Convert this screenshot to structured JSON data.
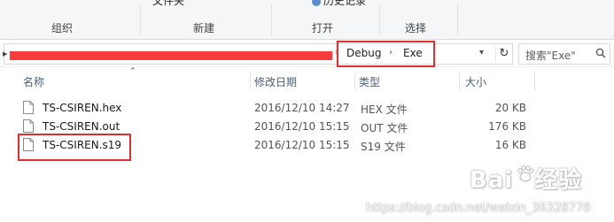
{
  "ribbon": {
    "fragments": [
      "文件夹",
      "历史记录"
    ],
    "groups": [
      "组织",
      "新建",
      "打开",
      "选择"
    ]
  },
  "address": {
    "crumbs": [
      "Debug",
      "Exe"
    ],
    "separator": "›"
  },
  "search": {
    "placeholder": "搜索\"Exe\""
  },
  "columns": {
    "name": "名称",
    "date": "修改日期",
    "type": "类型",
    "size": "大小"
  },
  "files": [
    {
      "name": "TS-CSIREN.hex",
      "date": "2016/12/10 14:27",
      "type": "HEX 文件",
      "size": "20 KB"
    },
    {
      "name": "TS-CSIREN.out",
      "date": "2016/12/10 15:15",
      "type": "OUT 文件",
      "size": "176 KB"
    },
    {
      "name": "TS-CSIREN.s19",
      "date": "2016/12/10 15:15",
      "type": "S19 文件",
      "size": "16 KB"
    }
  ],
  "watermark": {
    "logo_text": "Bai",
    "logo_suffix": "经验",
    "url": "https://blog.csdn.net/weixin_36328778"
  },
  "colors": {
    "annotation_red": "#e52d2d",
    "redaction": "#ff3b3b"
  }
}
